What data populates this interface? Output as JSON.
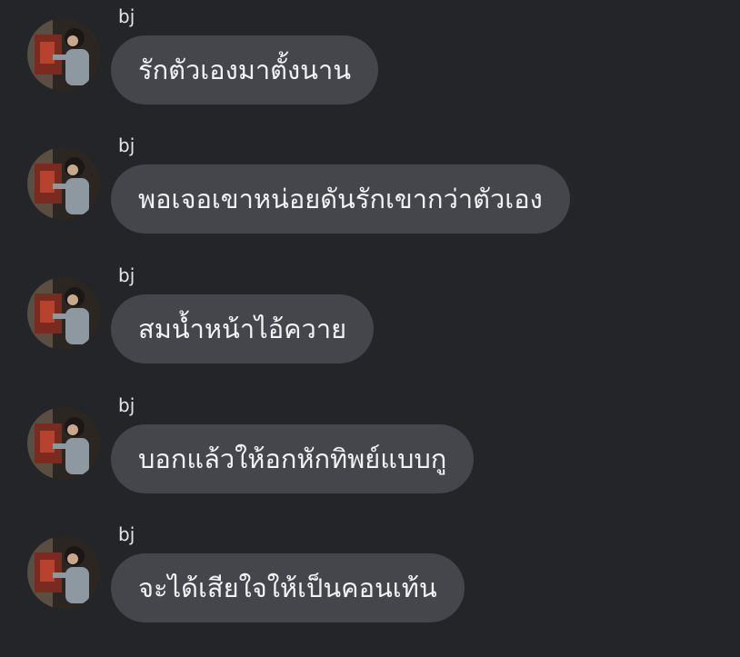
{
  "messages": [
    {
      "sender": "bj",
      "text": "รักตัวเองมาตั้งนาน"
    },
    {
      "sender": "bj",
      "text": "พอเจอเขาหน่อยดันรักเขากว่าตัวเอง"
    },
    {
      "sender": "bj",
      "text": "สมน้ำหน้าไอ้ควาย"
    },
    {
      "sender": "bj",
      "text": "บอกแล้วให้อกหักทิพย์แบบกู"
    },
    {
      "sender": "bj",
      "text": "จะได้เสียใจให้เป็นคอนเท้น"
    }
  ],
  "colors": {
    "background": "#242529",
    "bubble": "#45464c",
    "text": "#f2f2f4"
  }
}
